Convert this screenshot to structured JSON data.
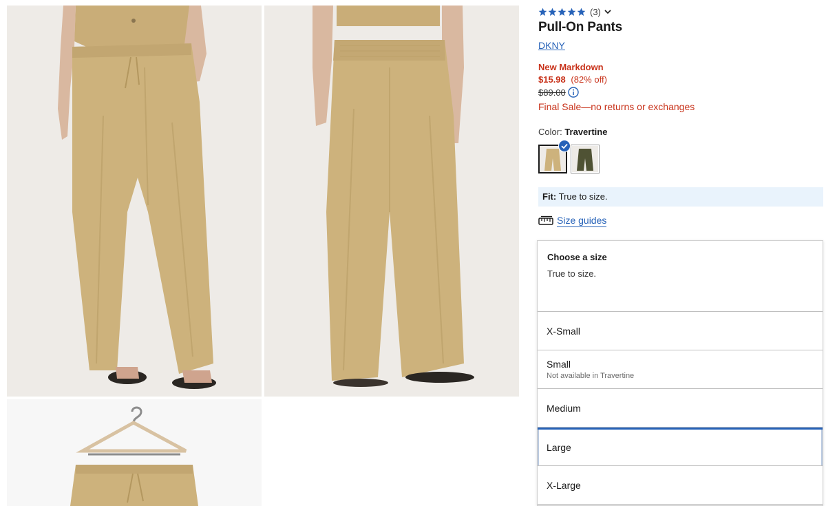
{
  "product": {
    "rating": {
      "stars": 5,
      "review_count": "(3)"
    },
    "title": "Pull-On Pants",
    "brand": "DKNY",
    "markdown_label": "New Markdown",
    "sale_price": "$15.98",
    "discount": "(82% off)",
    "original_price": "$89.00",
    "final_sale_note": "Final Sale—no returns or exchanges"
  },
  "color": {
    "label": "Color:",
    "selected": "Travertine",
    "swatches": [
      {
        "name": "Travertine",
        "hex": "#cdb27c",
        "selected": true
      },
      {
        "name": "Olive",
        "hex": "#4f5234",
        "selected": false
      }
    ]
  },
  "fit": {
    "label": "Fit:",
    "text": "True to size."
  },
  "size_guides": {
    "label": "Size guides"
  },
  "size_selector": {
    "heading": "Choose a size",
    "subheading": "True to size.",
    "options": [
      {
        "label": "X-Small",
        "note": ""
      },
      {
        "label": "Small",
        "note": "Not available in Travertine"
      },
      {
        "label": "Medium",
        "note": ""
      },
      {
        "label": "Large",
        "note": ""
      },
      {
        "label": "X-Large",
        "note": ""
      }
    ]
  },
  "colors": {
    "link": "#2662b8",
    "sale_red": "#c8321a",
    "fit_bg": "#e9f3fc",
    "star": "#2662b8",
    "fabric": "#cdb27c"
  },
  "icons": [
    "star-icon",
    "chevron-down-icon",
    "info-icon",
    "check-badge-icon",
    "ruler-icon"
  ]
}
